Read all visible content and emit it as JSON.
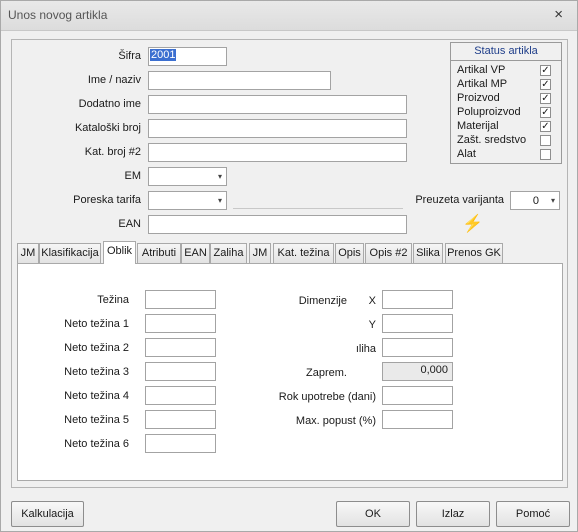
{
  "window": {
    "title": "Unos novog artikla",
    "close": "×"
  },
  "form": {
    "sifra_label": "Šifra",
    "sifra_value": "2001",
    "ime_label": "Ime / naziv",
    "dodatno_label": "Dodatno ime",
    "kataloski_label": "Kataloški broj",
    "katbroj2_label": "Kat. broj #2",
    "em_label": "EM",
    "poreska_label": "Poreska tarifa",
    "ean_label": "EAN",
    "varijanta_label": "Preuzeta varijanta",
    "varijanta_value": "0"
  },
  "status": {
    "title": "Status artikla",
    "items": [
      {
        "label": "Artikal VP",
        "checked": true
      },
      {
        "label": "Artikal MP",
        "checked": true
      },
      {
        "label": "Proizvod",
        "checked": true
      },
      {
        "label": "Poluproizvod",
        "checked": true
      },
      {
        "label": "Materijal",
        "checked": true
      },
      {
        "label": "Zašt. sredstvo",
        "checked": false
      },
      {
        "label": "Alat",
        "checked": false
      }
    ]
  },
  "tabs": [
    {
      "label": "JM"
    },
    {
      "label": "Klasifikacija"
    },
    {
      "label": "Oblik"
    },
    {
      "label": "Atributi"
    },
    {
      "label": "EAN"
    },
    {
      "label": "Zaliha"
    },
    {
      "label": "JM"
    },
    {
      "label": "Kat. težina"
    },
    {
      "label": "Opis"
    },
    {
      "label": "Opis #2"
    },
    {
      "label": "Slika"
    },
    {
      "label": "Prenos GK"
    }
  ],
  "active_tab": "Oblik",
  "oblik": {
    "tezina": "Težina",
    "neto1": "Neto težina 1",
    "neto2": "Neto težina 2",
    "neto3": "Neto težina 3",
    "neto4": "Neto težina 4",
    "neto5": "Neto težina 5",
    "neto6": "Neto težina 6",
    "dimenzije": "Dimenzije",
    "x": "X",
    "y": "Y",
    "z": "ıliha",
    "zaprem": "Zaprem.",
    "zaprem_value": "0,000",
    "rok": "Rok upotrebe (dani)",
    "popust": "Max. popust (%)"
  },
  "buttons": {
    "kalkulacija": "Kalkulacija",
    "ok": "OK",
    "izlaz": "Izlaz",
    "pomoc": "Pomoć"
  },
  "icons": {
    "combo_arrow": "▾",
    "check": "✓",
    "bolt": "⚡"
  }
}
